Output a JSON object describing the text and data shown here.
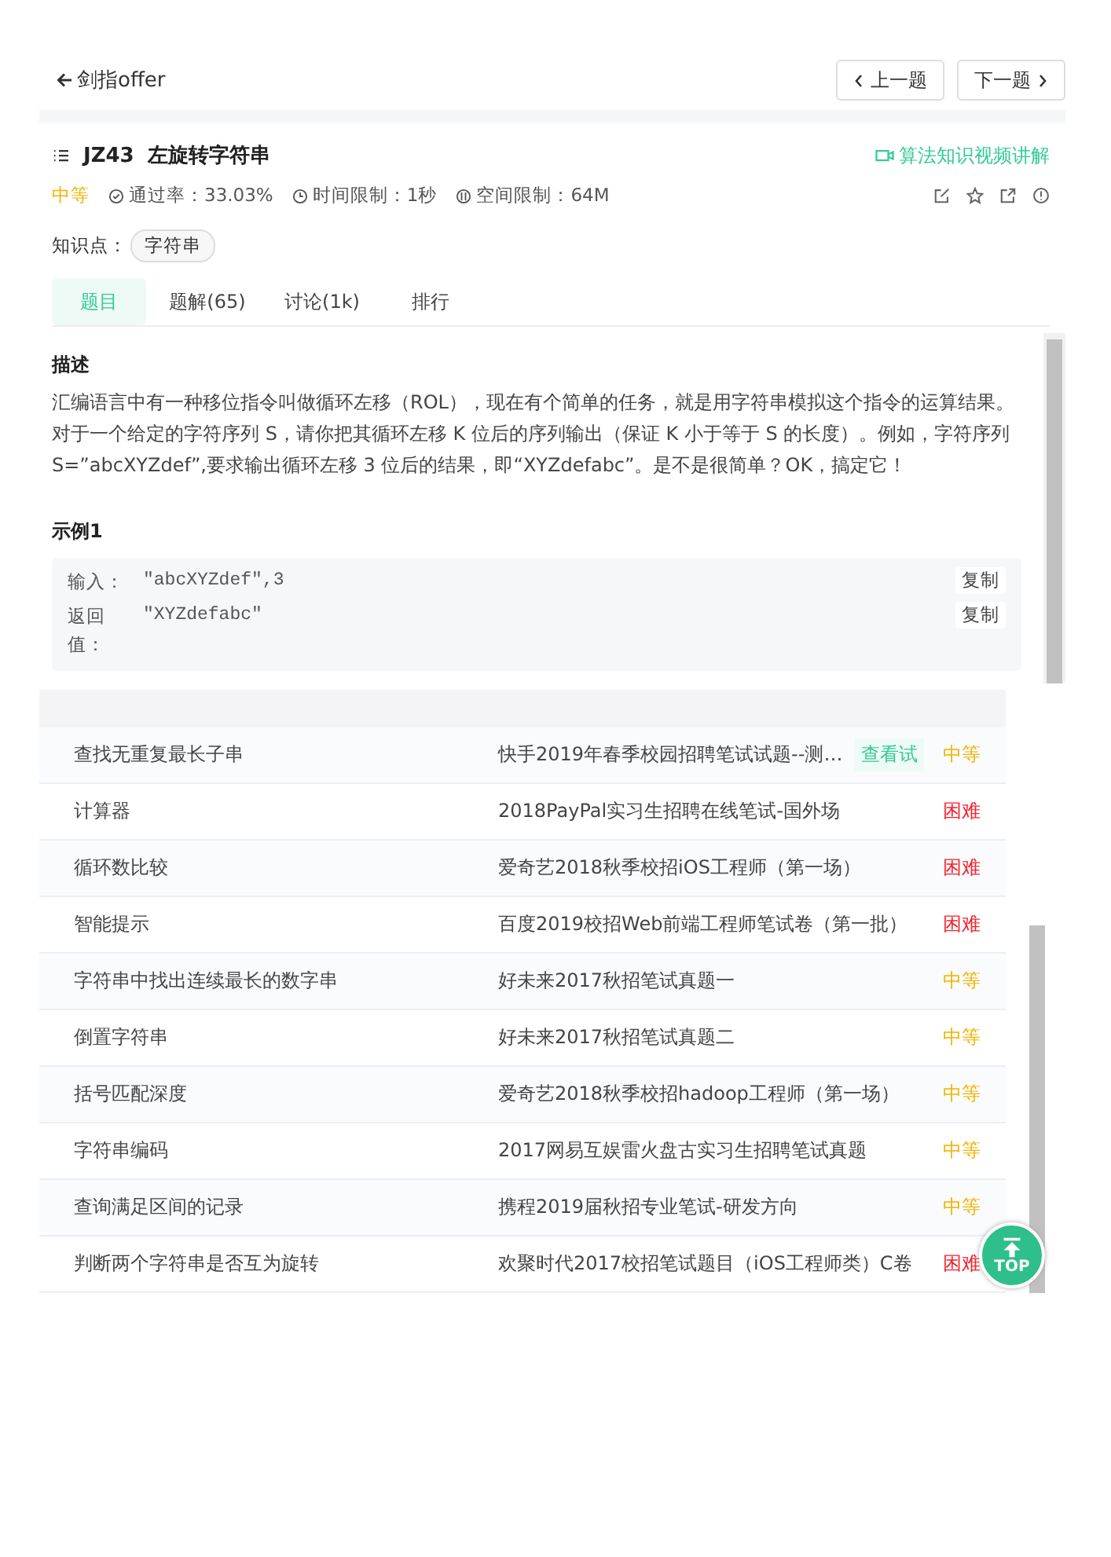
{
  "nav": {
    "back_label": "剑指offer",
    "prev_label": "上一题",
    "next_label": "下一题"
  },
  "problem": {
    "code": "JZ43",
    "title": "左旋转字符串",
    "video_link": "算法知识视频讲解",
    "difficulty": {
      "label": "中等",
      "kind": "medium"
    },
    "pass_rate": "通过率：33.03%",
    "time_limit": "时间限制：1秒",
    "memory_limit": "空间限制：64M",
    "topics_label": "知识点：",
    "topics": [
      "字符串"
    ]
  },
  "tabs": [
    {
      "label": "题目",
      "selected": true
    },
    {
      "label": "题解(65)",
      "selected": false
    },
    {
      "label": "讨论(1k)",
      "selected": false
    },
    {
      "label": "排行",
      "selected": false
    }
  ],
  "description": {
    "heading": "描述",
    "text": "汇编语言中有一种移位指令叫做循环左移（ROL），现在有个简单的任务，就是用字符串模拟这个指令的运算结果。对于一个给定的字符序列 S，请你把其循环左移 K 位后的序列输出（保证 K 小于等于 S 的长度）。例如，字符序列S=”abcXYZdef”,要求输出循环左移 3 位后的结果，即“XYZdefabc”。是不是很简单？OK，搞定它！"
  },
  "example": {
    "heading": "示例1",
    "rows": [
      {
        "label": "输入：",
        "value": "\"abcXYZdef\",3",
        "copy": "复制"
      },
      {
        "label": "返回值：",
        "value": "\"XYZdefabc\"",
        "copy": "复制"
      }
    ]
  },
  "table": {
    "rows": [
      {
        "title": "查找无重复最长子串",
        "source": "快手2019年春季校园招聘笔试试题--测…",
        "tag": "查看试",
        "difficulty": {
          "label": "中等",
          "kind": "medium"
        }
      },
      {
        "title": "计算器",
        "source": "2018PayPal实习生招聘在线笔试-国外场",
        "difficulty": {
          "label": "困难",
          "kind": "hard"
        }
      },
      {
        "title": "循环数比较",
        "source": "爱奇艺2018秋季校招iOS工程师（第一场）",
        "difficulty": {
          "label": "困难",
          "kind": "hard"
        }
      },
      {
        "title": "智能提示",
        "source": "百度2019校招Web前端工程师笔试卷（第一批）",
        "difficulty": {
          "label": "困难",
          "kind": "hard"
        }
      },
      {
        "title": "字符串中找出连续最长的数字串",
        "source": "好未来2017秋招笔试真题一",
        "difficulty": {
          "label": "中等",
          "kind": "medium"
        }
      },
      {
        "title": "倒置字符串",
        "source": "好未来2017秋招笔试真题二",
        "difficulty": {
          "label": "中等",
          "kind": "medium"
        }
      },
      {
        "title": "括号匹配深度",
        "source": "爱奇艺2018秋季校招hadoop工程师（第一场）",
        "difficulty": {
          "label": "中等",
          "kind": "medium"
        }
      },
      {
        "title": "字符串编码",
        "source": "2017网易互娱雷火盘古实习生招聘笔试真题",
        "difficulty": {
          "label": "中等",
          "kind": "medium"
        }
      },
      {
        "title": "查询满足区间的记录",
        "source": "携程2019届秋招专业笔试-研发方向",
        "difficulty": {
          "label": "中等",
          "kind": "medium"
        }
      },
      {
        "title": "判断两个字符串是否互为旋转",
        "source": "欢聚时代2017校招笔试题目（iOS工程师类）C卷",
        "difficulty": {
          "label": "困难",
          "kind": "hard"
        }
      }
    ]
  },
  "top_button": {
    "label": "TOP"
  }
}
